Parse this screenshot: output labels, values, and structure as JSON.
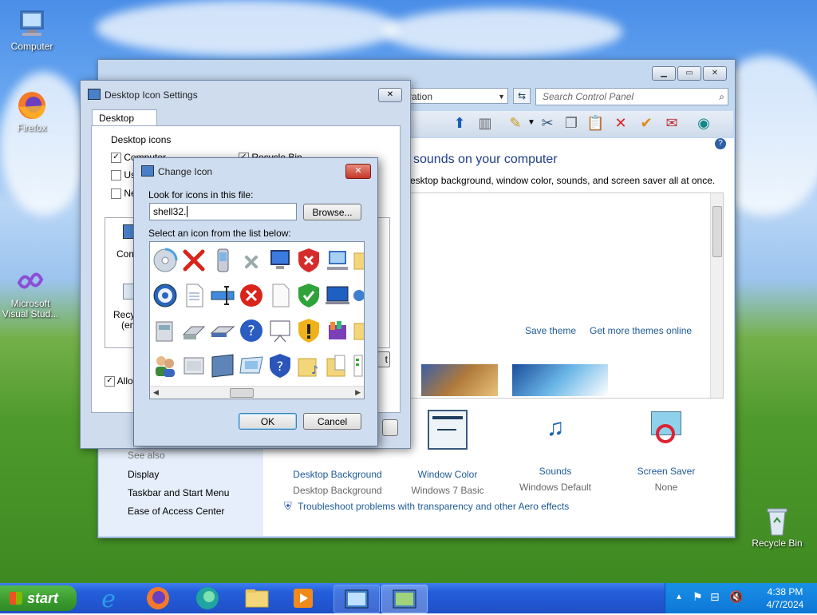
{
  "desktop": {
    "icons": [
      {
        "label": "Computer"
      },
      {
        "label": "Firefox"
      },
      {
        "label": "Microsoft Visual Stud..."
      },
      {
        "label": "Recycle Bin"
      }
    ]
  },
  "control_panel": {
    "address_fragment": "ration",
    "search_placeholder": "Search Control Panel",
    "heading": "sounds on your computer",
    "subheading": "esktop background, window color, sounds, and screen saver all at once.",
    "save_theme": "Save theme",
    "get_more_themes": "Get more themes online",
    "see_also_title": "See also",
    "see_also": [
      "Display",
      "Taskbar and Start Menu",
      "Ease of Access Center"
    ],
    "settings": [
      {
        "label": "Desktop Background",
        "value": "Desktop Background"
      },
      {
        "label": "Window Color",
        "value": "Windows 7 Basic"
      },
      {
        "label": "Sounds",
        "value": "Windows Default"
      },
      {
        "label": "Screen Saver",
        "value": "None"
      }
    ],
    "troubleshoot": "Troubleshoot problems with transparency and other Aero effects"
  },
  "desktop_icon_settings": {
    "title": "Desktop Icon Settings",
    "tab": "Desktop Icons",
    "group": "Desktop icons",
    "checkboxes": [
      {
        "label": "Computer",
        "checked": true
      },
      {
        "label": "Recycle Bin",
        "checked": true
      },
      {
        "label": "Use",
        "checked": false
      },
      {
        "label": "Ne",
        "checked": false
      }
    ],
    "preview_labels": [
      "Comp",
      "Recyc",
      "(emp"
    ],
    "allow_label": "Allow",
    "hidden_button_fragment": "t"
  },
  "change_icon": {
    "title": "Change Icon",
    "look_label": "Look for icons in this file:",
    "file_value": "shell32.",
    "browse": "Browse...",
    "select_label": "Select an icon from the list below:",
    "ok": "OK",
    "cancel": "Cancel"
  },
  "taskbar": {
    "start": "start",
    "time": "4:38 PM",
    "date": "4/7/2024"
  },
  "colors": {
    "link": "#1c5a96",
    "taskbar": "#245edb",
    "start": "#3a9a2e"
  }
}
